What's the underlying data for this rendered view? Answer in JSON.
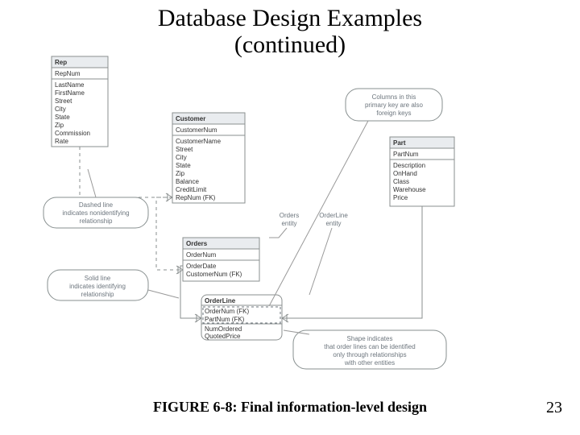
{
  "slide": {
    "title_line1": "Database Design Examples",
    "title_line2": "(continued)",
    "caption": "FIGURE 6-8: Final information-level design",
    "page": "23"
  },
  "entities": {
    "rep": {
      "name": "Rep",
      "pk": "RepNum",
      "attrs": [
        "LastName",
        "FirstName",
        "Street",
        "City",
        "State",
        "Zip",
        "Commission",
        "Rate"
      ]
    },
    "customer": {
      "name": "Customer",
      "pk": "CustomerNum",
      "attrs": [
        "CustomerName",
        "Street",
        "City",
        "State",
        "Zip",
        "Balance",
        "CreditLimit",
        "RepNum (FK)"
      ]
    },
    "orders": {
      "name": "Orders",
      "pk": "OrderNum",
      "attrs": [
        "OrderDate",
        "CustomerNum (FK)"
      ]
    },
    "orderline": {
      "name": "OrderLine",
      "pk": [
        "OrderNum (FK)",
        "PartNum (FK)"
      ],
      "attrs": [
        "NumOrdered",
        "QuotedPrice"
      ]
    },
    "part": {
      "name": "Part",
      "pk": "PartNum",
      "attrs": [
        "Description",
        "OnHand",
        "Class",
        "Warehouse",
        "Price"
      ]
    }
  },
  "labels": {
    "orders_entity": [
      "Orders",
      "entity"
    ],
    "orderline_entity": [
      "OrderLine",
      "entity"
    ]
  },
  "callouts": {
    "col_in_pk": [
      "Columns in this",
      "primary key are also",
      "foreign keys"
    ],
    "dashed": [
      "Dashed line",
      "indicates nonidentifying",
      "relationship"
    ],
    "solid": [
      "Solid line",
      "indicates identifying",
      "relationship"
    ],
    "shape": [
      "Shape indicates",
      "that order lines can be identified",
      "only through relationships",
      "with other entities"
    ]
  }
}
